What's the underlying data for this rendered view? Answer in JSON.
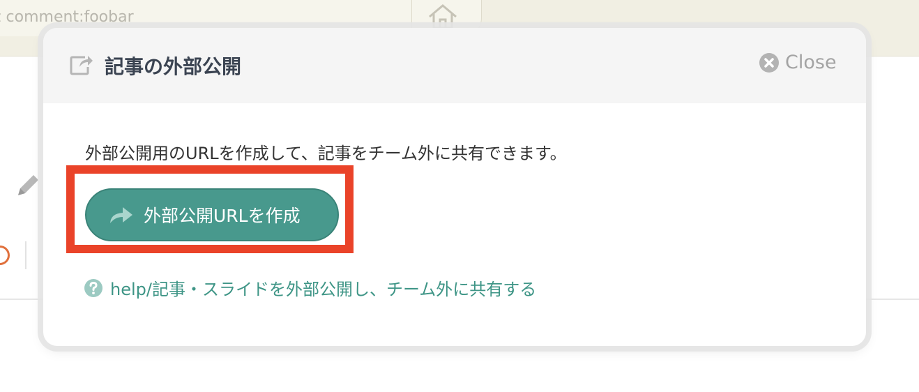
{
  "background": {
    "search_text": "z comment:foobar"
  },
  "modal": {
    "title": "記事の外部公開",
    "close_label": "Close",
    "description": "外部公開用のURLを作成して、記事をチーム外に共有できます。",
    "create_button_label": "外部公開URLを作成",
    "help_link_label": "help/記事・スライドを外部公開し、チーム外に共有する"
  },
  "colors": {
    "accent": "#48998d",
    "link": "#3e9586",
    "highlight": "#ea4329",
    "title": "#3b4452",
    "muted": "#a3a3a3"
  },
  "icons": {
    "header": "share-square-icon",
    "close": "times-circle-icon",
    "button": "share-arrow-icon",
    "help": "question-circle-icon",
    "background_home": "home-icon",
    "background_edit": "pencil-icon"
  }
}
